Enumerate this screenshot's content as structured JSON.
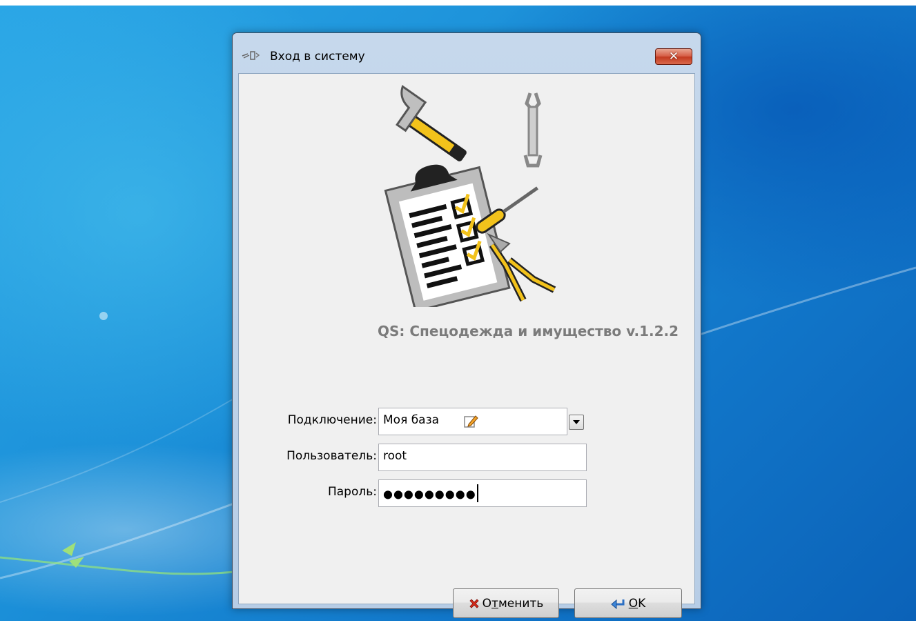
{
  "window": {
    "title": "Вход в систему",
    "close_label": "✕",
    "app_title": "QS: Спецодежда и имущество v.1.2.2"
  },
  "form": {
    "connection_label": "Подключение:",
    "connection_value": "Моя база",
    "user_label": "Пользователь:",
    "user_value": "root",
    "password_label": "Пароль:",
    "password_value": "●●●●●●●●●"
  },
  "buttons": {
    "cancel_first": "О",
    "cancel_mnemonic": "т",
    "cancel_rest": "менить",
    "ok_mnemonic": "O",
    "ok_rest": "K"
  },
  "icons": {
    "title": "app-logo-icon",
    "close": "close-icon",
    "dropdown": "chevron-down-icon",
    "edit": "pencil-edit-icon",
    "cancel": "red-x-icon",
    "ok": "enter-arrow-icon",
    "logo": "tools-clipboard-illustration"
  }
}
